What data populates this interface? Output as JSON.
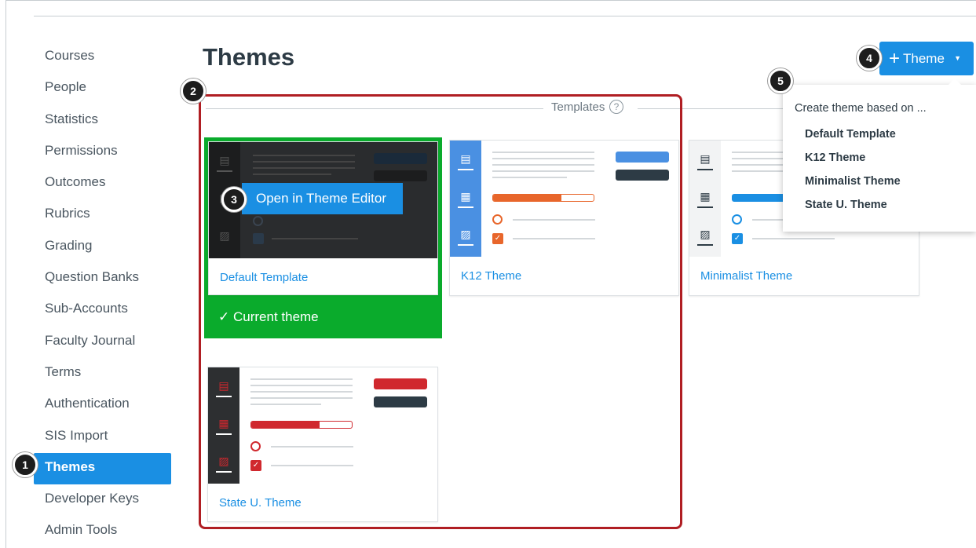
{
  "page": {
    "title": "Themes"
  },
  "nav": {
    "items": [
      {
        "label": "Courses"
      },
      {
        "label": "People"
      },
      {
        "label": "Statistics"
      },
      {
        "label": "Permissions"
      },
      {
        "label": "Outcomes"
      },
      {
        "label": "Rubrics"
      },
      {
        "label": "Grading"
      },
      {
        "label": "Question Banks"
      },
      {
        "label": "Sub-Accounts"
      },
      {
        "label": "Faculty Journal"
      },
      {
        "label": "Terms"
      },
      {
        "label": "Authentication"
      },
      {
        "label": "SIS Import"
      },
      {
        "label": "Themes",
        "active": true
      },
      {
        "label": "Developer Keys"
      },
      {
        "label": "Admin Tools"
      }
    ]
  },
  "add_button": {
    "label": "Theme",
    "plus": "+",
    "caret": "▼"
  },
  "menu": {
    "heading": "Create theme based on ...",
    "items": [
      "Default Template",
      "K12 Theme",
      "Minimalist Theme",
      "State U. Theme"
    ]
  },
  "templates": {
    "label": "Templates",
    "help": "?",
    "cards": [
      {
        "name": "Default Template",
        "current": true,
        "current_label": "Current theme",
        "check": "✓",
        "overlay_button": "Open in Theme Editor"
      },
      {
        "name": "K12 Theme"
      },
      {
        "name": "Minimalist Theme"
      },
      {
        "name": "State U. Theme"
      }
    ]
  },
  "callouts": [
    "1",
    "2",
    "3",
    "4",
    "5"
  ],
  "colors": {
    "brand_blue": "#1a8fe3",
    "current_green": "#0aab2c",
    "highlight_red": "#b01e23",
    "k12_orange": "#e8662b",
    "stateu_red": "#d0282e",
    "dark_navy": "#2d3b45"
  }
}
